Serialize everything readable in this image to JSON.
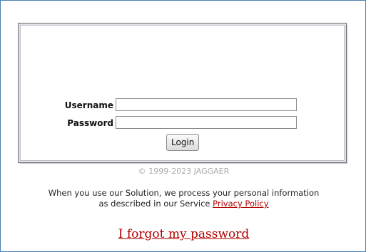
{
  "login": {
    "username_label": "Username",
    "password_label": "Password",
    "username_value": "",
    "password_value": "",
    "login_button": "Login"
  },
  "footer": {
    "copyright": "© 1999-2023 JAGGAER",
    "notice_line1": "When you use our Solution, we process your personal information",
    "notice_line2_prefix": "as described in our Service ",
    "privacy_link": "Privacy Policy",
    "forgot_password_link": "I forgot my password"
  },
  "colors": {
    "frame_border": "#4a7fb5",
    "link": "#b30000",
    "copyright": "#a9a9a9"
  }
}
